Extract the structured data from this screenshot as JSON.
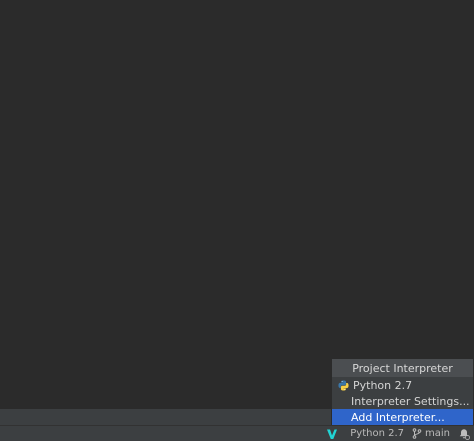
{
  "popup": {
    "header": "Project Interpreter",
    "interpreter_item": "Python 2.7",
    "settings_item": "Interpreter Settings...",
    "add_item": "Add Interpreter..."
  },
  "status_bar": {
    "interpreter": "Python 2.7",
    "branch": "main",
    "icons": [
      "v-logo-icon",
      "git-branch-icon",
      "notifications-icon"
    ]
  },
  "colors": {
    "editor_bg": "#2b2b2b",
    "panel_bg": "#3c3f41",
    "selection": "#2f65ca",
    "v_logo": "#21d4d4"
  }
}
